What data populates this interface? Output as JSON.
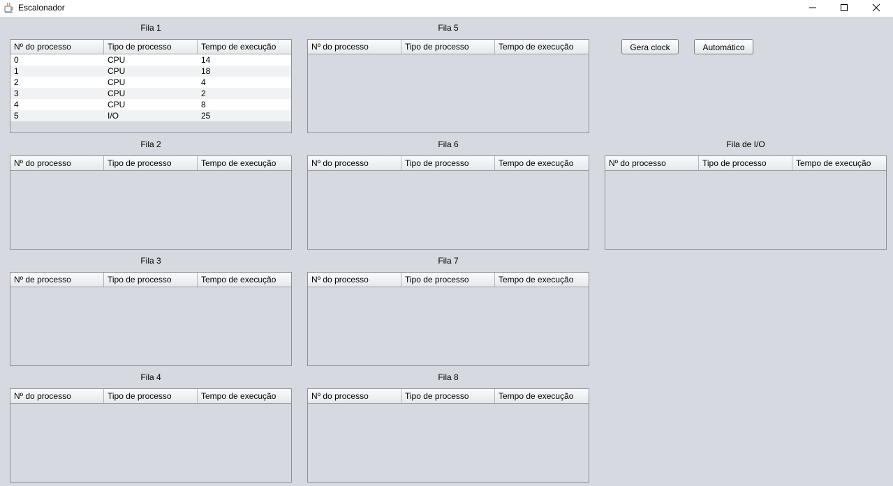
{
  "window": {
    "title": "Escalonador",
    "icon": "java-cup-icon"
  },
  "buttons": {
    "gera_clock": "Gera clock",
    "automatico": "Automático"
  },
  "queues": {
    "fila1": {
      "label": "Fila 1",
      "columns": [
        "Nº do processo",
        "Tipo de processo",
        "Tempo de execução"
      ],
      "rows": [
        [
          "0",
          "CPU",
          "14"
        ],
        [
          "1",
          "CPU",
          "18"
        ],
        [
          "2",
          "CPU",
          "4"
        ],
        [
          "3",
          "CPU",
          "2"
        ],
        [
          "4",
          "CPU",
          "8"
        ],
        [
          "5",
          "I/O",
          "25"
        ]
      ]
    },
    "fila2": {
      "label": "Fila 2",
      "columns": [
        "Nº do processo",
        "Tipo de processo",
        "Tempo de execução"
      ],
      "rows": []
    },
    "fila3": {
      "label": "Fila 3",
      "columns": [
        "Nº de processo",
        "Tipo de processo",
        "Tempo de execução"
      ],
      "rows": []
    },
    "fila4": {
      "label": "Fila 4",
      "columns": [
        "Nº do processo",
        "Tipo de processo",
        "Tempo de execução"
      ],
      "rows": []
    },
    "fila5": {
      "label": "Fila 5",
      "columns": [
        "Nº do processo",
        "Tipo de processo",
        "Tempo de execução"
      ],
      "rows": []
    },
    "fila6": {
      "label": "Fila 6",
      "columns": [
        "Nº do processo",
        "Tipo de processo",
        "Tempo de execução"
      ],
      "rows": []
    },
    "fila7": {
      "label": "Fila 7",
      "columns": [
        "Nº do processo",
        "Tipo de processo",
        "Tempo de execução"
      ],
      "rows": []
    },
    "fila8": {
      "label": "Fila 8",
      "columns": [
        "Nº do processo",
        "Tipo de processo",
        "Tempo de execução"
      ],
      "rows": []
    },
    "fila_io": {
      "label": "Fila de I/O",
      "columns": [
        "Nº do processo",
        "Tipo de processo",
        "Tempo de execução"
      ],
      "rows": []
    }
  }
}
